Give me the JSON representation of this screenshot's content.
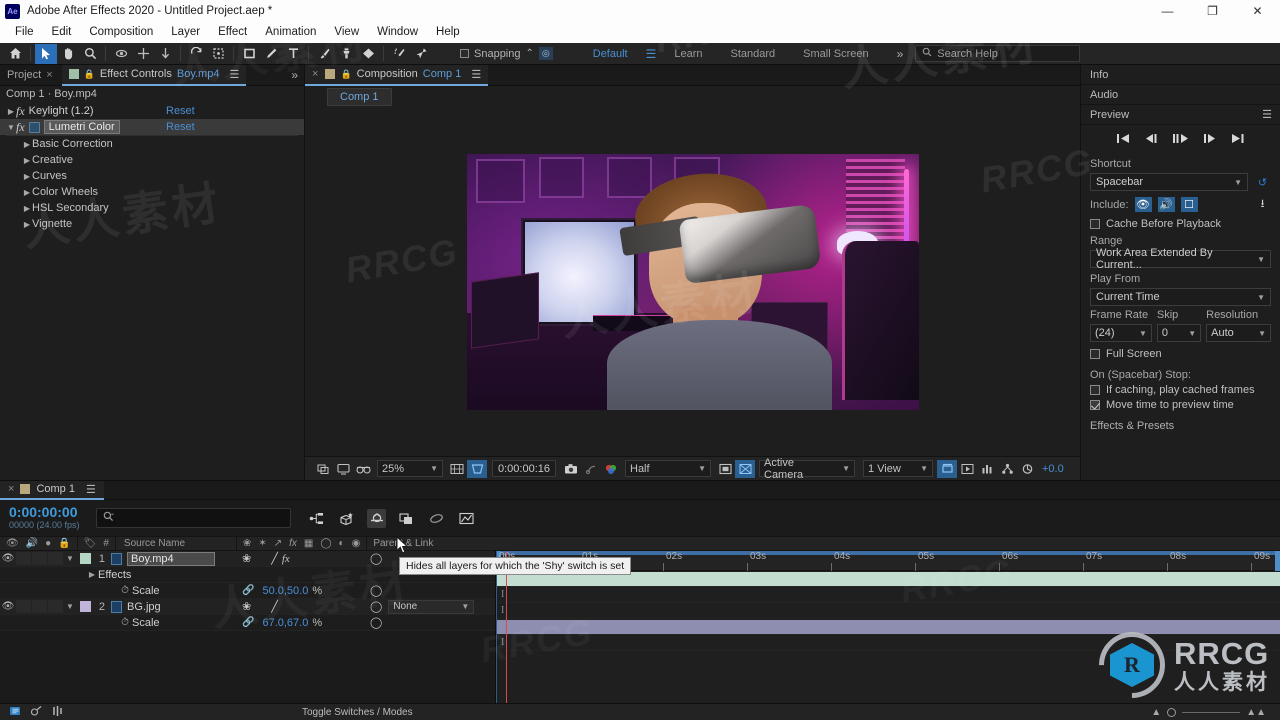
{
  "titlebar": {
    "app_icon": "ae-logo",
    "title": "Adobe After Effects 2020 - Untitled Project.aep *",
    "minimize": "—",
    "maximize": "❐",
    "close": "✕"
  },
  "menubar": {
    "items": [
      "File",
      "Edit",
      "Composition",
      "Layer",
      "Effect",
      "Animation",
      "View",
      "Window",
      "Help"
    ]
  },
  "toolbar": {
    "tools": [
      {
        "name": "home-icon",
        "active": false
      },
      {
        "name": "selection-tool-icon",
        "active": true
      },
      {
        "name": "hand-tool-icon",
        "active": false
      },
      {
        "name": "zoom-tool-icon",
        "active": false
      },
      {
        "name": "orbit-camera-tool-icon",
        "active": false
      },
      {
        "name": "pan-camera-tool-icon",
        "active": false
      },
      {
        "name": "dolly-camera-tool-icon",
        "active": false
      },
      {
        "name": "rotation-tool-icon",
        "active": false
      },
      {
        "name": "anchor-point-tool-icon",
        "active": false
      },
      {
        "name": "shape-tool-icon",
        "active": false
      },
      {
        "name": "pen-tool-icon",
        "active": false
      },
      {
        "name": "type-tool-icon",
        "active": false
      },
      {
        "name": "brush-tool-icon",
        "active": false
      },
      {
        "name": "clone-stamp-tool-icon",
        "active": false
      },
      {
        "name": "eraser-tool-icon",
        "active": false
      },
      {
        "name": "roto-brush-tool-icon",
        "active": false
      },
      {
        "name": "puppet-pin-tool-icon",
        "active": false
      }
    ],
    "snapping_label": "Snapping",
    "snapping_checked": false,
    "workspaces": [
      {
        "label": "Default",
        "active": true
      },
      {
        "label": "Learn",
        "active": false
      },
      {
        "label": "Standard",
        "active": false
      },
      {
        "label": "Small Screen",
        "active": false
      }
    ],
    "more_chevron": "»",
    "search_placeholder": "Search Help"
  },
  "effect_controls": {
    "tabs": [
      {
        "label": "Project",
        "active": false,
        "closable": true
      },
      {
        "label": "Effect Controls",
        "value": "Boy.mp4",
        "active": true
      }
    ],
    "more_chevron": "»",
    "header": "Comp 1 · Boy.mp4",
    "effects": [
      {
        "name": "Keylight (1.2)",
        "reset": "Reset",
        "expanded": false,
        "selected": false
      },
      {
        "name": "Lumetri Color",
        "reset": "Reset",
        "expanded": true,
        "selected": true
      }
    ],
    "lumetri_sections": [
      "Basic Correction",
      "Creative",
      "Curves",
      "Color Wheels",
      "HSL Secondary",
      "Vignette"
    ]
  },
  "composition_panel": {
    "tab_label": "Composition",
    "tab_value": "Comp 1",
    "chip_label": "Comp 1",
    "toolbar": {
      "zoom": "25%",
      "timecode": "0:00:00:16",
      "resolution": "Half",
      "camera": "Active Camera",
      "views": "1 View",
      "exposure": "+0.0"
    }
  },
  "right_panel": {
    "info_label": "Info",
    "audio_label": "Audio",
    "preview_label": "Preview",
    "transport": [
      "◀▌",
      "◀❘",
      "❘▶",
      "❘▶",
      "▶❘"
    ],
    "shortcut_label": "Shortcut",
    "shortcut_value": "Spacebar",
    "include_label": "Include:",
    "cache_label": "Cache Before Playback",
    "cache_checked": false,
    "range_label": "Range",
    "range_value": "Work Area Extended By Current...",
    "play_from_label": "Play From",
    "play_from_value": "Current Time",
    "frame_rate_label": "Frame Rate",
    "frame_rate_value": "(24)",
    "skip_label": "Skip",
    "skip_value": "0",
    "resolution_label": "Resolution",
    "resolution_value": "Auto",
    "full_screen_label": "Full Screen",
    "full_screen_checked": false,
    "on_stop_label": "On (Spacebar) Stop:",
    "if_caching_label": "If caching, play cached frames",
    "if_caching_checked": false,
    "move_time_label": "Move time to preview time",
    "move_time_checked": true,
    "effects_presets_label": "Effects & Presets"
  },
  "timeline": {
    "tab_label": "Comp 1",
    "current_time": "0:00:00:00",
    "frame_info": "00000 (24.00 fps)",
    "search_placeholder": "",
    "columns": [
      "Source Name",
      "Parent & Link"
    ],
    "layers": [
      {
        "number": "1",
        "name": "Boy.mp4",
        "selected": true,
        "color": "#b6d6c4",
        "bar_color": "green",
        "parent": null,
        "children": [
          {
            "type": "group",
            "name": "Effects"
          },
          {
            "type": "prop",
            "name": "Scale",
            "value": "50.0,50.0",
            "unit": "%"
          }
        ]
      },
      {
        "number": "2",
        "name": "BG.jpg",
        "selected": false,
        "color": "#c0b4d8",
        "bar_color": "purple",
        "parent": "None",
        "children": [
          {
            "type": "prop",
            "name": "Scale",
            "value": "67.0,67.0",
            "unit": "%"
          }
        ]
      }
    ],
    "ruler_ticks": [
      "00s",
      "01s",
      "02s",
      "03s",
      "04s",
      "05s",
      "06s",
      "07s",
      "08s",
      "09s"
    ],
    "status_label": "Toggle Switches / Modes"
  },
  "tooltip": {
    "text": "Hides all layers for which the 'Shy' switch is set"
  },
  "watermarks": {
    "chinese": "人人素材",
    "rrcg": "RRCG",
    "logo_text": "RRCG",
    "logo_cn": "人人素材",
    "logo_mark": "R"
  },
  "colors": {
    "accent_blue": "#4a8fd4",
    "playhead_red": "#d94a4a",
    "layer_green": "#c3ddd0",
    "layer_purple": "#8e8eb0",
    "logo_blue": "#1b9fe0"
  }
}
